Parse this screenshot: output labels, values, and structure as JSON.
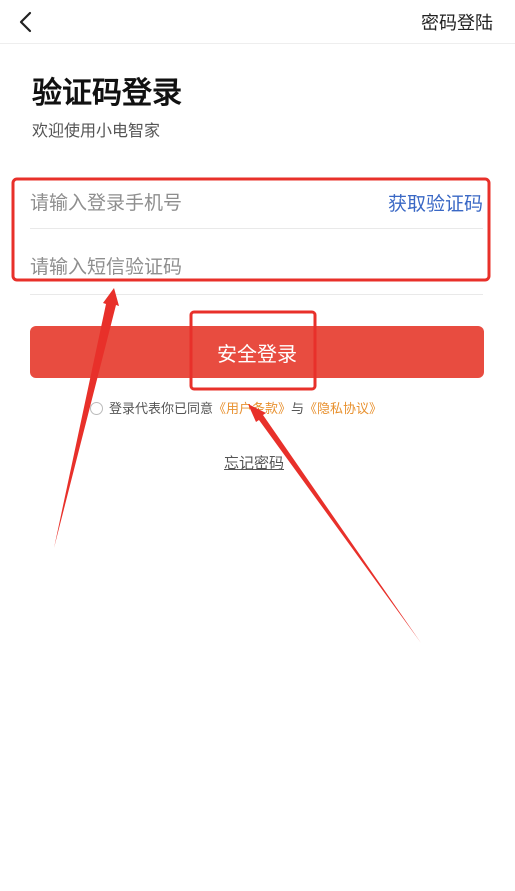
{
  "header": {
    "back_icon": "chevron-left-icon",
    "password_login": "密码登陆"
  },
  "page": {
    "title": "验证码登录",
    "subtitle": "欢迎使用小电智家"
  },
  "form": {
    "phone_placeholder": "请输入登录手机号",
    "get_code": "获取验证码",
    "code_placeholder": "请输入短信验证码",
    "submit": "安全登录"
  },
  "agreement": {
    "prefix": "登录代表你已同意",
    "terms": "《用户条款》",
    "connector": "与",
    "privacy": "《隐私协议》"
  },
  "forgot_password": "忘记密码",
  "annotations": {
    "color": "#e8302a"
  }
}
